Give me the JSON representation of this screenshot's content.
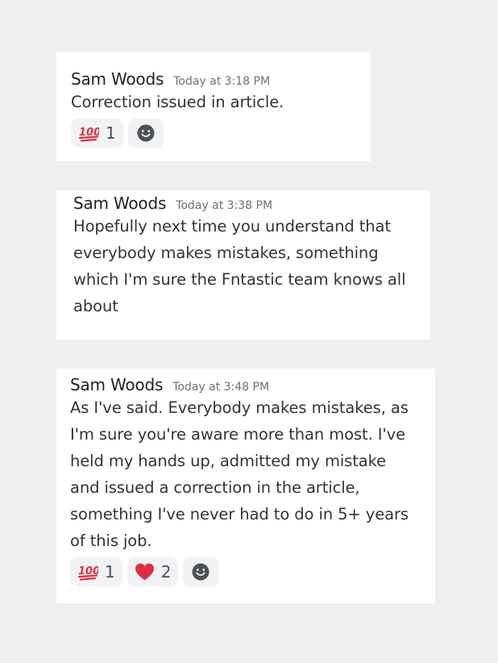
{
  "messages": [
    {
      "author": "Sam Woods",
      "timestamp": "Today at 3:18 PM",
      "text": "Correction issued in article.",
      "reactions": [
        {
          "emoji": "hundred-points",
          "count": "1"
        }
      ]
    },
    {
      "author": "Sam Woods",
      "timestamp": "Today at 3:38 PM",
      "text": "Hopefully next time you understand that everybody makes mistakes, something which I'm sure the Fntastic team knows all about"
    },
    {
      "author": "Sam Woods",
      "timestamp": "Today at 3:48 PM",
      "text": "As I've said. Everybody makes mistakes, as I'm sure you're aware more than most. I've held my hands up, admitted my mistake and issued a correction in the article, something I've never had to do in 5+ years of this job.",
      "reactions": [
        {
          "emoji": "hundred-points",
          "count": "1"
        },
        {
          "emoji": "red-heart",
          "count": "2"
        }
      ]
    }
  ],
  "colors": {
    "background": "#efefef",
    "card": "#ffffff",
    "author": "#1f1f22",
    "timestamp": "#6d6f78",
    "text": "#313338",
    "reaction_bg": "#f1f2f4",
    "hundred_red": "#dd2e44",
    "heart_red": "#dd2e44",
    "add_reaction_icon": "#4e5058"
  }
}
